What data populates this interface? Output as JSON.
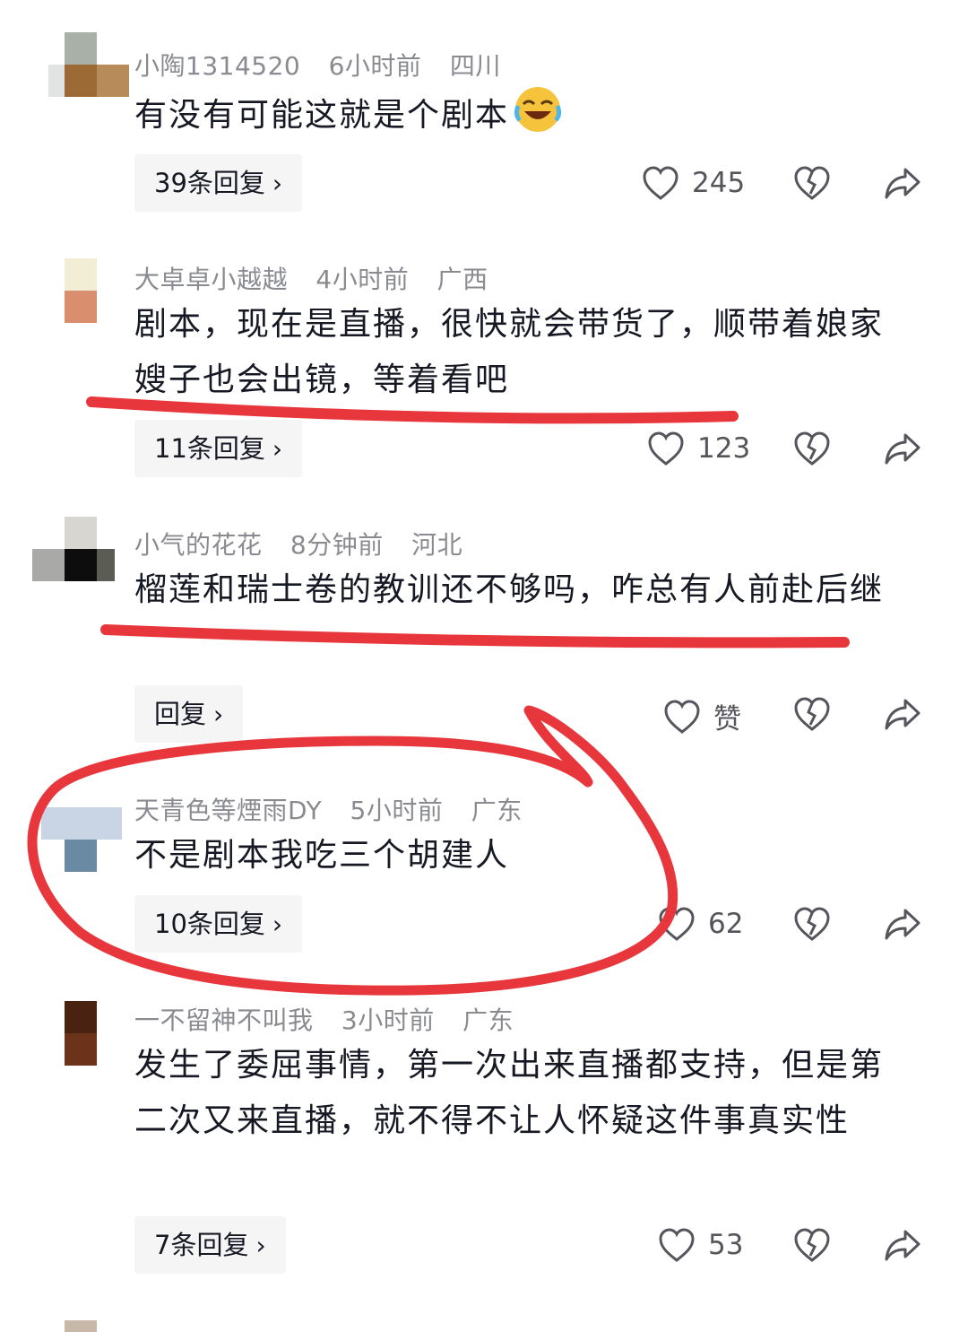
{
  "colors": {
    "annotation_red": "#e8373c",
    "meta_gray": "#8a8b91",
    "text_dark": "#161823",
    "reply_bg": "#f5f5f6"
  },
  "comments": [
    {
      "username": "小陶1314520",
      "time": "6小时前",
      "location": "四川",
      "text": "有没有可能这就是个剧本",
      "emoji": "laughing-tears-icon",
      "reply_label": "39条回复",
      "likes": "245"
    },
    {
      "username": "大卓卓小越越",
      "time": "4小时前",
      "location": "广西",
      "text": "剧本，现在是直播，很快就会带货了，顺带着娘家嫂子也会出镜，等着看吧",
      "reply_label": "11条回复",
      "likes": "123"
    },
    {
      "username": "小气的花花",
      "time": "8分钟前",
      "location": "河北",
      "text": "榴莲和瑞士卷的教训还不够吗，咋总有人前赴后继",
      "reply_label": "回复",
      "likes": "赞"
    },
    {
      "username": "天青色等煙雨DY",
      "time": "5小时前",
      "location": "广东",
      "text": "不是剧本我吃三个胡建人",
      "reply_label": "10条回复",
      "likes": "62"
    },
    {
      "username": "一不留神不叫我",
      "time": "3小时前",
      "location": "广东",
      "text": "发生了委屈事情，第一次出来直播都支持，但是第二次又来直播，就不得不让人怀疑这件事真实性",
      "reply_label": "7条回复",
      "likes": "53"
    }
  ],
  "icons": {
    "like": "heart-icon",
    "dislike": "broken-heart-icon",
    "share": "share-arrow-icon",
    "chevron": "›"
  }
}
